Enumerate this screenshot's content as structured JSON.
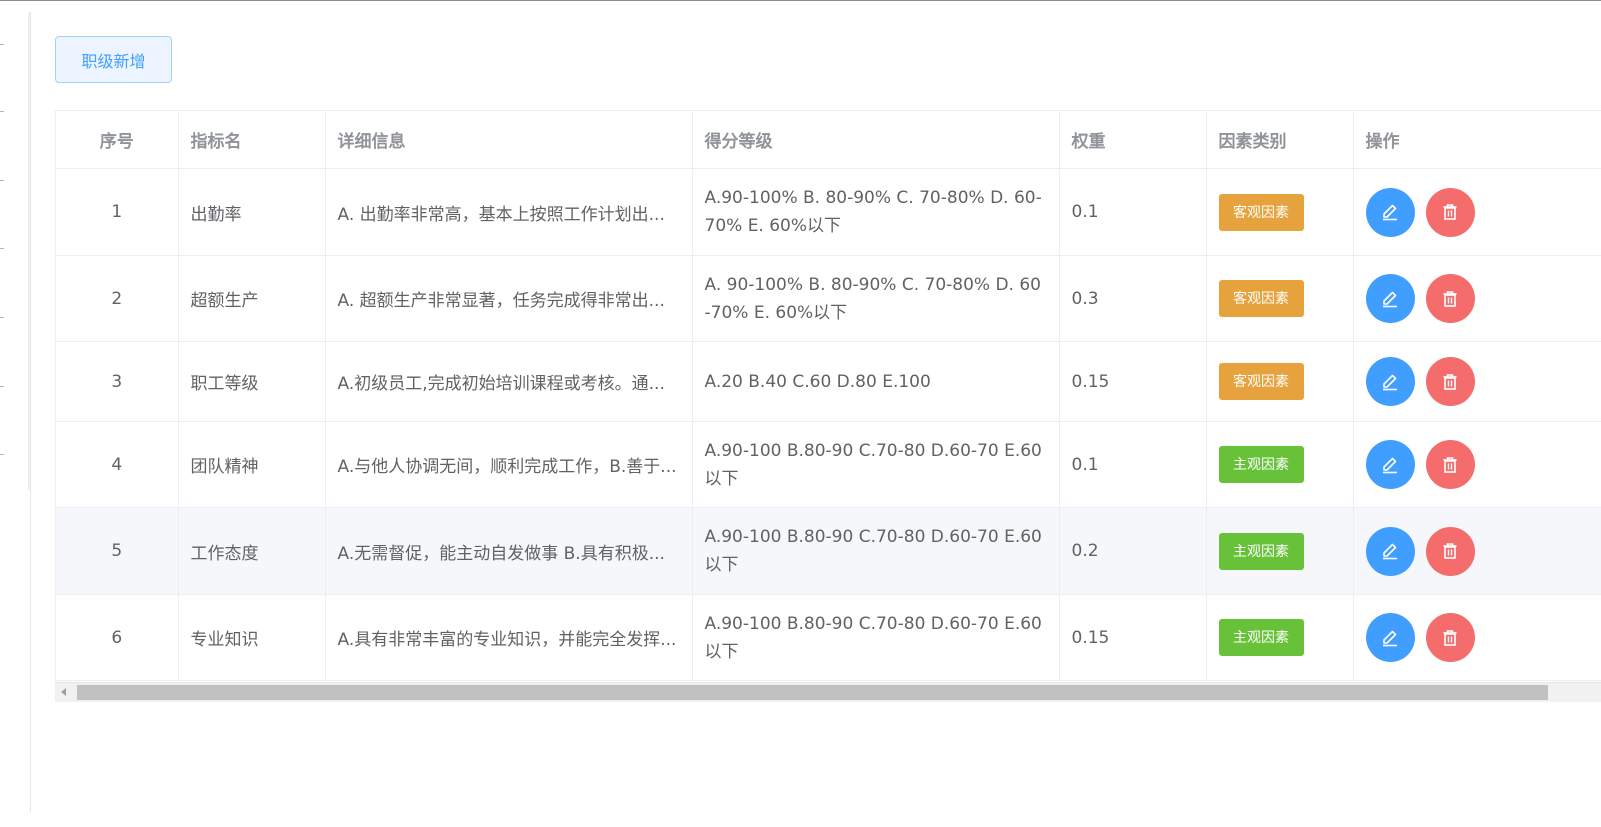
{
  "toolbar": {
    "add_label": "职级新增"
  },
  "table": {
    "columns": {
      "index": "序号",
      "name": "指标名",
      "detail": "详细信息",
      "grade": "得分等级",
      "weight": "权重",
      "factor": "因素类别",
      "ops": "操作"
    },
    "rows": [
      {
        "index": "1",
        "name": "出勤率",
        "detail": "A. 出勤率非常高，基本上按照工作计划出...",
        "grade": "A.90-100% B. 80-90% C. 70-80% D. 60-70% E. 60%以下",
        "weight": "0.1",
        "factor": "客观因素"
      },
      {
        "index": "2",
        "name": "超额生产",
        "detail": "A. 超额生产非常显著，任务完成得非常出...",
        "grade": "A. 90-100% B. 80-90% C. 70-80% D. 60-70% E. 60%以下",
        "weight": "0.3",
        "factor": "客观因素"
      },
      {
        "index": "3",
        "name": "职工等级",
        "detail": "A.初级员工,完成初始培训课程或考核。通...",
        "grade": "A.20 B.40 C.60 D.80 E.100",
        "weight": "0.15",
        "factor": "客观因素"
      },
      {
        "index": "4",
        "name": "团队精神",
        "detail": "A.与他人协调无间，顺利完成工作，B.善于...",
        "grade": "A.90-100 B.80-90 C.70-80 D.60-70 E.60以下",
        "weight": "0.1",
        "factor": "主观因素"
      },
      {
        "index": "5",
        "name": "工作态度",
        "detail": "A.无需督促，能主动自发做事 B.具有积极...",
        "grade": "A.90-100 B.80-90 C.70-80 D.60-70 E.60以下",
        "weight": "0.2",
        "factor": "主观因素"
      },
      {
        "index": "6",
        "name": "专业知识",
        "detail": "A.具有非常丰富的专业知识，并能完全发挥...",
        "grade": "A.90-100 B.80-90 C.70-80 D.60-70 E.60以下",
        "weight": "0.15",
        "factor": "主观因素"
      }
    ]
  },
  "icons": {
    "edit": "edit-icon",
    "delete": "delete-icon"
  },
  "colors": {
    "primary": "#409eff",
    "danger": "#f56c6c",
    "warning": "#e6a23c",
    "success": "#67c23a"
  }
}
